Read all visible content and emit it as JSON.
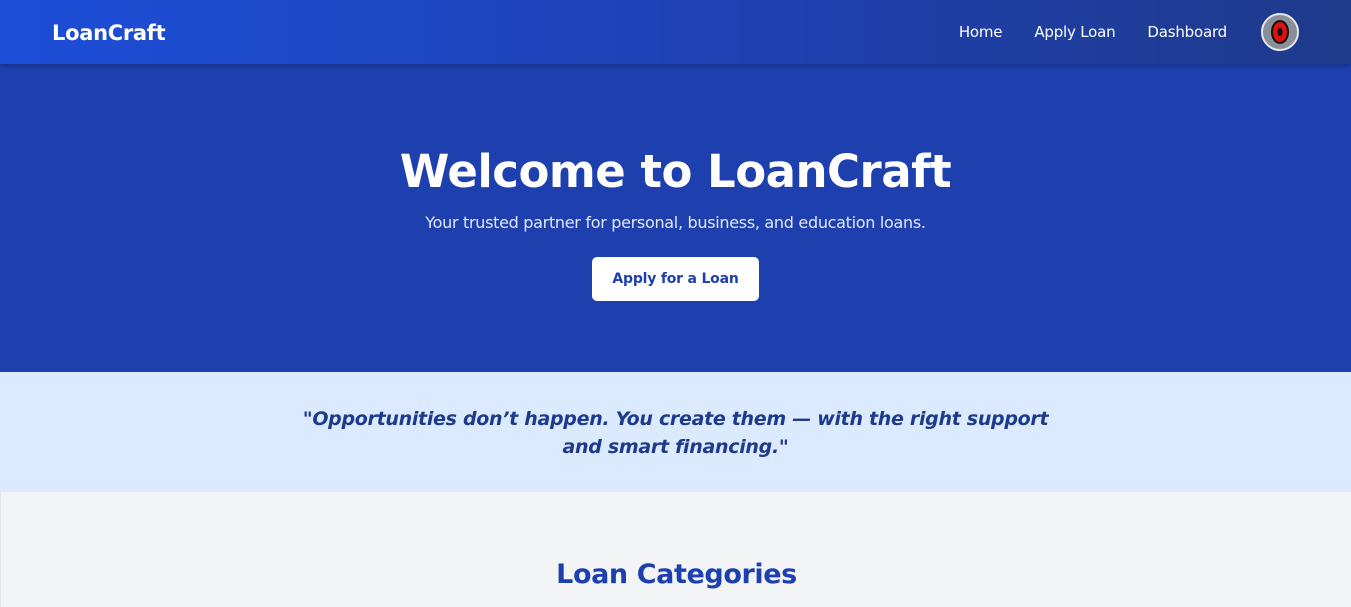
{
  "navbar": {
    "brand": "LoanCraft",
    "links": [
      {
        "label": "Home"
      },
      {
        "label": "Apply Loan"
      },
      {
        "label": "Dashboard"
      }
    ],
    "avatar_icon": "user-avatar-icon"
  },
  "hero": {
    "title": "Welcome to LoanCraft",
    "subtitle": "Your trusted partner for personal, business, and education loans.",
    "cta_label": "Apply for a Loan"
  },
  "quote": {
    "text": "\"Opportunities don’t happen. You create them — with the right support and smart financing.\""
  },
  "categories": {
    "title": "Loan Categories"
  },
  "colors": {
    "primary": "#1e40af",
    "accent_light": "#dbeafe",
    "background": "#f3f4f6"
  }
}
